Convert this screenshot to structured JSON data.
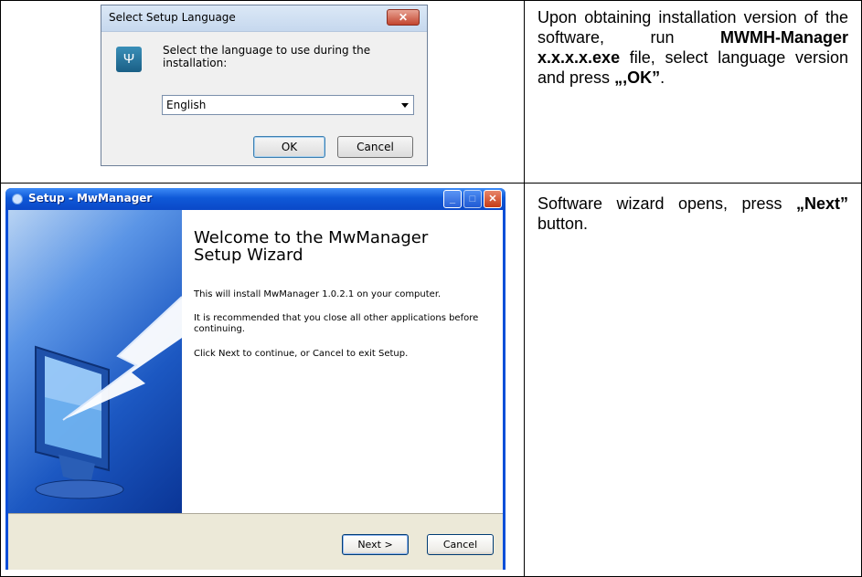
{
  "steps": [
    {
      "instruction": {
        "t1": "Upon obtaining installation version of the software, run ",
        "b1": "MWMH-Manager x.x.x.x.exe",
        "t2": " file, select language version and press ",
        "b2": "„,OK”",
        "t3": "."
      },
      "dialog": {
        "title": "Select Setup Language",
        "close_glyph": "✕",
        "icon_glyph": "Ψ",
        "message": "Select the language to use during the installation:",
        "language_value": "English",
        "ok_label": "OK",
        "cancel_label": "Cancel"
      }
    },
    {
      "instruction": {
        "t1": "Software wizard opens, press ",
        "b1": "„Next”",
        "t2": " button."
      },
      "dialog": {
        "title": "Setup - MwManager",
        "minimize_glyph": "_",
        "maximize_glyph": "□",
        "close_glyph": "✕",
        "heading_line1": "Welcome to the MwManager",
        "heading_line2": "Setup Wizard",
        "p1": "This will install MwManager 1.0.2.1 on your computer.",
        "p2": "It is recommended that you close all other applications before continuing.",
        "p3": "Click Next to continue, or Cancel to exit Setup.",
        "next_label": "Next >",
        "cancel_label": "Cancel"
      }
    }
  ]
}
